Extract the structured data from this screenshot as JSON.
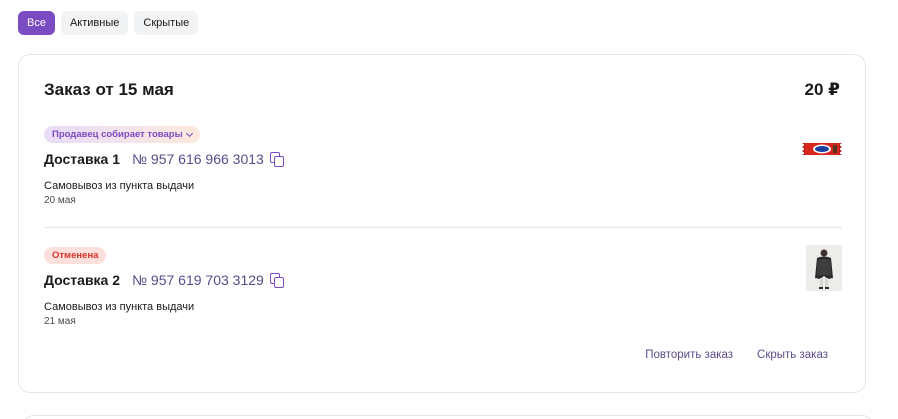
{
  "filters": [
    {
      "label": "Все",
      "active": true
    },
    {
      "label": "Активные",
      "active": false
    },
    {
      "label": "Скрытые",
      "active": false
    }
  ],
  "order": {
    "title": "Заказ от 15 мая",
    "total": "20 ₽",
    "shipments": [
      {
        "status": "Продавец собирает товары",
        "name": "Доставка 1",
        "number": "№ 957 616 966 3013",
        "method": "Самовывоз из пункта выдачи",
        "date": "20 мая",
        "thumb": "chocolate-bar-image"
      },
      {
        "status": "Отменена",
        "name": "Доставка 2",
        "number": "№ 957 619 703 3129",
        "method": "Самовывоз из пункта выдачи",
        "date": "21 мая",
        "thumb": "person-in-coat-image"
      }
    ],
    "actions": {
      "repeat": "Повторить заказ",
      "hide": "Скрыть заказ"
    }
  },
  "colors": {
    "accent": "#7b4bc4",
    "link": "#5b4a8a",
    "cancelled": "#d9322b"
  }
}
